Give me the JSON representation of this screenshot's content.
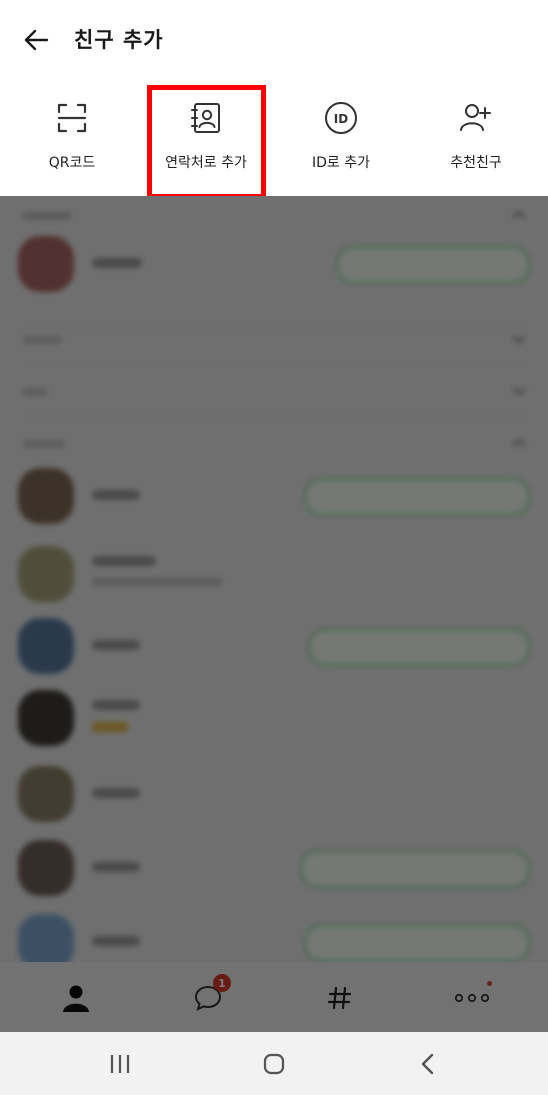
{
  "header": {
    "back_icon": "arrow-left-icon",
    "title": "친구 추가"
  },
  "actions": [
    {
      "label": "QR코드",
      "icon": "qr-scan-icon"
    },
    {
      "label": "연락처로 추가",
      "icon": "contact-book-icon",
      "highlighted": true
    },
    {
      "label": "ID로 추가",
      "icon": "id-circle-icon"
    },
    {
      "label": "추천친구",
      "icon": "add-person-icon"
    }
  ],
  "colors": {
    "highlight": "#ff0000",
    "badge": "#d93a2b",
    "pill_border": "#7fd18a"
  },
  "tabbar": {
    "friends_icon": "person-icon",
    "chats_icon": "chat-bubble-icon",
    "chats_badge": "1",
    "openchat_icon": "hash-icon",
    "more_icon": "more-dots-icon"
  },
  "system_nav": {
    "recents_icon": "recents-icon",
    "home_icon": "home-icon",
    "back_icon": "chevron-left-icon"
  }
}
